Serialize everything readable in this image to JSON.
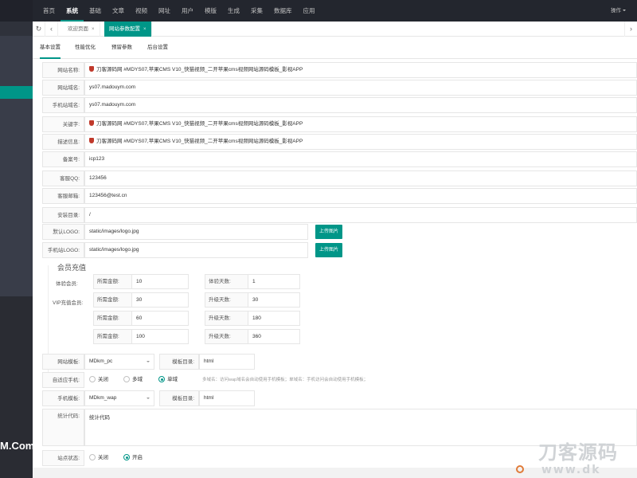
{
  "topnav": {
    "items": [
      "首页",
      "系统",
      "基础",
      "文章",
      "视频",
      "网址",
      "用户",
      "模版",
      "生成",
      "采集",
      "数据库",
      "应用"
    ],
    "active_index": 1,
    "right_label": "操作"
  },
  "sidebar": {
    "brand": "M.Com"
  },
  "tabsbar": {
    "tabs": [
      {
        "label": "欢迎页面",
        "close": "×"
      },
      {
        "label": "网站参数配置",
        "close": "×"
      }
    ]
  },
  "subtabs": [
    "基本设置",
    "性能优化",
    "预留参数",
    "后台设置"
  ],
  "fields": {
    "site_name": {
      "label": "网站名称:",
      "value": "刀客源码网 #MDYS07,苹果CMS V10_快猫视频_二开苹果cms视频网站源码模板_影视APP"
    },
    "site_domain": {
      "label": "网站域名:",
      "value": "ys07.madouym.com"
    },
    "mobile_domain": {
      "label": "手机站域名:",
      "value": "ys07.madouym.com"
    },
    "keywords": {
      "label": "关键字:",
      "value": "刀客源码网 #MDYS07,苹果CMS V10_快猫视频_二开苹果cms视频网站源码模板_影视APP"
    },
    "description": {
      "label": "描述信息:",
      "value": "刀客源码网 #MDYS07,苹果CMS V10_快猫视频_二开苹果cms视频网站源码模板_影视APP"
    },
    "icp": {
      "label": "备案号:",
      "value": "icp123"
    },
    "qq": {
      "label": "客服QQ:",
      "value": "123456"
    },
    "email": {
      "label": "客服邮箱:",
      "value": "123456@test.cn"
    },
    "install_dir": {
      "label": "安装目录:",
      "value": "/"
    },
    "logo": {
      "label": "默认LOGO:",
      "value": "static/images/logo.jpg",
      "button": "上传图片"
    },
    "mobile_logo": {
      "label": "手机站LOGO:",
      "value": "static/images/logo.jpg",
      "button": "上传图片"
    }
  },
  "member": {
    "title": "会员充值",
    "trial_label": "体验会员:",
    "vip_label": "VIP充值会员:",
    "amount_label": "所需金额:",
    "trial_days_label": "体验天数:",
    "upgrade_days_label": "升级天数:",
    "rows": [
      {
        "amount": "10",
        "days": "1"
      },
      {
        "amount": "30",
        "days": "30"
      },
      {
        "amount": "60",
        "days": "180"
      },
      {
        "amount": "100",
        "days": "360"
      }
    ]
  },
  "template": {
    "label": "网站模板:",
    "value": "MDkm_pc",
    "dir_label": "模板目录:",
    "dir_value": "html"
  },
  "adapt": {
    "label": "自适应手机:",
    "options": [
      "关闭",
      "多域",
      "单域"
    ],
    "selected": 2,
    "hint": "多域名：访问wap域名会自动使用手机模板；单域名：手机访问会自动使用手机模板；"
  },
  "mobile_template": {
    "label": "手机模板:",
    "value": "MDkm_wap",
    "dir_label": "模板目录:",
    "dir_value": "html"
  },
  "stats": {
    "label": "统计代码:",
    "value": "统计代码"
  },
  "status": {
    "label": "站点状态:",
    "options": [
      "关闭",
      "开启"
    ],
    "selected": 1
  },
  "watermark": {
    "line1": "刀客源码",
    "line2": "www.dk"
  },
  "colors": {
    "accent": "#009688",
    "topbar": "#23262e",
    "sidebar": "#393d49"
  }
}
